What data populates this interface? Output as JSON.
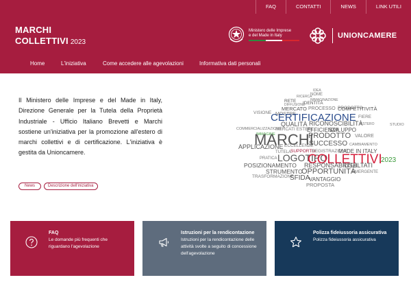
{
  "topbar": {
    "links": [
      "FAQ",
      "CONTATTI",
      "NEWS",
      "LINK UTILI"
    ]
  },
  "header": {
    "brand_line1": "MARCHI",
    "brand_line2": "COLLETTIVI",
    "brand_year": "2023",
    "ministry_line1": "Ministero delle Imprese",
    "ministry_line2": "e del Made in Italy",
    "partner_name": "UNIONCAMERE",
    "colors": {
      "brand": "#a61d3f",
      "flag_green": "#2e8b3f",
      "flag_white": "#ffffff",
      "flag_red": "#d8262e"
    }
  },
  "nav": {
    "items": [
      "Home",
      "L'iniziativa",
      "Come accedere alle agevolazioni",
      "Informativa dati personali"
    ]
  },
  "intro": {
    "paragraph": "Il Ministero delle Imprese e del Made in Italy, Direzione Generale per la Tutela della Proprietà Industriale - Ufficio Italiano Brevetti e Marchi sostiene un'iniziativa per la promozione all'estero di marchi collettivi e di certificazione. L'iniziativa è gestita da Unioncamere.",
    "tags": [
      "News",
      "Descrizione dell'iniziativa"
    ]
  },
  "wordcloud": {
    "words": [
      {
        "t": "IDEA",
        "c": "#777777"
      },
      {
        "t": "NOME",
        "c": "#777777"
      },
      {
        "t": "RICERCA",
        "c": "#777777"
      },
      {
        "t": "IMMAGINAZIONE",
        "c": "#777777"
      },
      {
        "t": "RETE",
        "c": "#555555"
      },
      {
        "t": "IDENTITÀ",
        "c": "#555555"
      },
      {
        "t": "DIFFUSIONE",
        "c": "#777777"
      },
      {
        "t": "PRODOTTO",
        "c": "#777777"
      },
      {
        "t": "MERCATO",
        "c": "#555555"
      },
      {
        "t": "PROCESSO",
        "c": "#777777"
      },
      {
        "t": "COMPETITIVITÀ",
        "c": "#555555"
      },
      {
        "t": "MOSTRE",
        "c": "#777777"
      },
      {
        "t": "VISIONE",
        "c": "#777777"
      },
      {
        "t": "CERTIFICAZIONE",
        "c": "#2b4c8c"
      },
      {
        "t": "FIERE",
        "c": "#777777"
      },
      {
        "t": "QUALITÀ",
        "c": "#555555"
      },
      {
        "t": "RICONOSCIBILITÀ",
        "c": "#555555"
      },
      {
        "t": "ESTERO",
        "c": "#777777"
      },
      {
        "t": "STUDIO",
        "c": "#777777"
      },
      {
        "t": "COMMERCIALIZZAZIONE",
        "c": "#777777"
      },
      {
        "t": "MERCATI ESTERI",
        "c": "#777777"
      },
      {
        "t": "EFFICIENZA",
        "c": "#555555"
      },
      {
        "t": "SVILUPPO",
        "c": "#555555"
      },
      {
        "t": "IMMAGINE",
        "c": "#3a9a3a"
      },
      {
        "t": "MARCHI",
        "c": "#555555"
      },
      {
        "t": "PRODOTTO",
        "c": "#555555"
      },
      {
        "t": "VALORE",
        "c": "#777777"
      },
      {
        "t": "SUCCESSO",
        "c": "#555555"
      },
      {
        "t": "APPLICAZIONE",
        "c": "#555555"
      },
      {
        "t": "ECCELLENZE",
        "c": "#777777"
      },
      {
        "t": "CAMBIAMENTO",
        "c": "#777777"
      },
      {
        "t": "TUTELA",
        "c": "#777777"
      },
      {
        "t": "SUPPORTO",
        "c": "#a61d3f"
      },
      {
        "t": "REGISTRAZIONE",
        "c": "#777777"
      },
      {
        "t": "MADE IN ITALY",
        "c": "#555555"
      },
      {
        "t": "PRATICA",
        "c": "#777777"
      },
      {
        "t": "LOGOTIPO",
        "c": "#555555"
      },
      {
        "t": "COLLETTIVI",
        "c": "#d4213d"
      },
      {
        "t": "2023",
        "c": "#3a9a3a"
      },
      {
        "t": "POSIZIONAMENTO",
        "c": "#555555"
      },
      {
        "t": "RESPONSABILITÀ",
        "c": "#555555"
      },
      {
        "t": "RISULTATI",
        "c": "#555555"
      },
      {
        "t": "STRUMENTO",
        "c": "#555555"
      },
      {
        "t": "OPPORTUNITÀ",
        "c": "#555555"
      },
      {
        "t": "EMERGENTE",
        "c": "#777777"
      },
      {
        "t": "TRASFORMAZIONE",
        "c": "#777777"
      },
      {
        "t": "SFIDA",
        "c": "#555555"
      },
      {
        "t": "VANTAGGIO",
        "c": "#555555"
      },
      {
        "t": "PROPOSTA",
        "c": "#777777"
      }
    ]
  },
  "cards": [
    {
      "title": "FAQ",
      "desc": "Le domande più frequenti che riguardano l'agevolazione",
      "icon": "question-icon",
      "color": "#a61d3f"
    },
    {
      "title": "Istruzioni per la rendicontazione",
      "desc": "Istruzioni per la rendicontazione delle attività svolte a seguito di concessione dell'agevolazione",
      "icon": "megaphone-icon",
      "color": "#5e6c7d"
    },
    {
      "title": "Polizza fideiussoria assicurativa",
      "desc": "Polizza fideiussoria assicurativa",
      "icon": "star-icon",
      "color": "#17395a"
    }
  ]
}
